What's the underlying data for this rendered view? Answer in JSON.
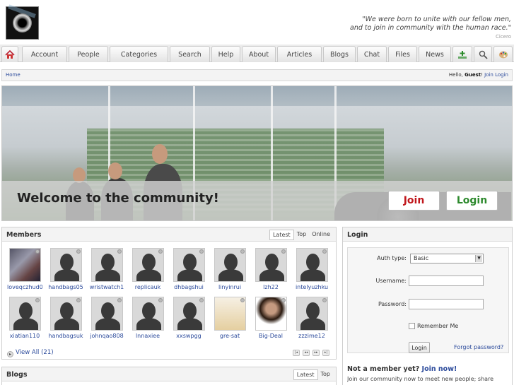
{
  "header": {
    "quote_line1": "\"We were born to unite with our fellow men,",
    "quote_line2": "and to join in community with the human race.\"",
    "quote_author": "Cicero"
  },
  "nav": {
    "tabs": [
      "Account",
      "People",
      "Categories",
      "Search",
      "Help",
      "About",
      "Articles",
      "Blogs",
      "Chat",
      "Files",
      "News"
    ],
    "icons": [
      "home-icon",
      "add-content-icon",
      "search-icon",
      "palette-icon"
    ]
  },
  "breadcrumb": {
    "home": "Home",
    "greeting": "Hello, ",
    "guest": "Guest",
    "sep": "! ",
    "join": "Join",
    "login": "Login"
  },
  "hero": {
    "title": "Welcome to the community!",
    "join_label": "Join",
    "login_label": "Login"
  },
  "members": {
    "title": "Members",
    "tabs": [
      "Latest",
      "Top",
      "Online"
    ],
    "list": [
      {
        "name": "loveqczhud0",
        "photo": "photo1"
      },
      {
        "name": "handbags05",
        "photo": ""
      },
      {
        "name": "wristwatch1",
        "photo": ""
      },
      {
        "name": "replicauk",
        "photo": ""
      },
      {
        "name": "dhbagshui",
        "photo": ""
      },
      {
        "name": "linyinrui",
        "photo": ""
      },
      {
        "name": "lzh22",
        "photo": ""
      },
      {
        "name": "intelyuzhku",
        "photo": ""
      },
      {
        "name": "xiatian110",
        "photo": ""
      },
      {
        "name": "handbagsuk",
        "photo": ""
      },
      {
        "name": "johnqao808",
        "photo": ""
      },
      {
        "name": "lnnaxiee",
        "photo": ""
      },
      {
        "name": "xxswpgg",
        "photo": ""
      },
      {
        "name": "gre-sat",
        "photo": "photo2"
      },
      {
        "name": "Big-Deal",
        "photo": "photo3"
      },
      {
        "name": "zzzime12",
        "photo": ""
      }
    ],
    "view_all": "View All (21)"
  },
  "login": {
    "title": "Login",
    "auth_label": "Auth type:",
    "auth_value": "Basic",
    "username_label": "Username:",
    "username_value": "",
    "password_label": "Password:",
    "password_value": "",
    "remember_label": "Remember Me",
    "submit_label": "Login",
    "forgot_label": "Forgot password?",
    "not_member": "Not a member yet? ",
    "join_now": "Join now!",
    "join_desc": "Join our community now to meet new people; share"
  },
  "blogs": {
    "title": "Blogs",
    "tabs": [
      "Latest",
      "Top"
    ]
  }
}
